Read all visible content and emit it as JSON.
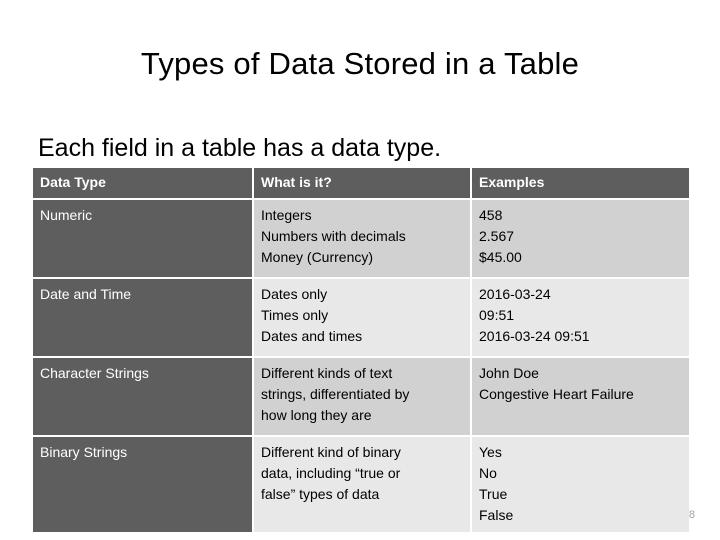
{
  "slide": {
    "title": "Types of Data Stored in a Table",
    "subtitle": "Each field in a table has a data type.",
    "page_number": "8",
    "colors": {
      "header_background": "#5e5e5e",
      "header_text": "#ffffff",
      "label_cell_background": "#5e5e5e",
      "row_band_dark": "#d1d1d1",
      "row_band_light": "#e8e8e8",
      "body_text": "#000000",
      "page_number_text": "#a6a6a6",
      "slide_background": "#ffffff"
    }
  },
  "table": {
    "headers": [
      "Data Type",
      "What is it?",
      "Examples"
    ],
    "rows": [
      {
        "type": "Numeric",
        "what_is_it": [
          "Integers",
          "Numbers with decimals",
          "Money (Currency)"
        ],
        "examples": [
          "458",
          "2.567",
          "$45.00"
        ]
      },
      {
        "type": "Date and Time",
        "what_is_it": [
          "Dates only",
          "Times only",
          "Dates and times"
        ],
        "examples": [
          "2016-03-24",
          "09:51",
          "2016-03-24 09:51"
        ]
      },
      {
        "type": "Character Strings",
        "what_is_it": [
          "Different kinds of text",
          "strings, differentiated by",
          "how long they are"
        ],
        "examples": [
          "John Doe",
          "Congestive Heart Failure"
        ]
      },
      {
        "type": "Binary Strings",
        "what_is_it": [
          "Different kind of binary",
          "data, including “true or",
          "false” types of data"
        ],
        "examples": [
          "Yes",
          "No",
          "True",
          "False"
        ]
      }
    ]
  }
}
